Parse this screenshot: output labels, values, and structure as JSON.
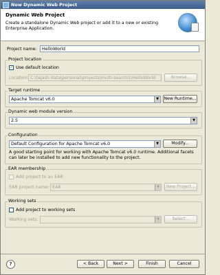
{
  "window": {
    "title": "New Dynamic Web Project"
  },
  "banner": {
    "title": "Dynamic Web Project",
    "description": "Create a standalone Dynamic Web project or add it to a new or existing Enterprise Application.",
    "icon": "globe-wizard-icon"
  },
  "project": {
    "name_label": "Project name:",
    "name_value": "HelloWorld"
  },
  "location": {
    "group_title": "Project location",
    "use_default_label": "Use default location",
    "use_default_checked": true,
    "location_label": "Location:",
    "location_value": "C:\\tejash data\\personal\\projects\\multi-search1\\HelloWorld",
    "browse_label": "Browse..."
  },
  "target_runtime": {
    "group_title": "Target runtime",
    "value": "Apache Tomcat v6.0",
    "new_runtime_label": "New Runtime..."
  },
  "module_version": {
    "group_title": "Dynamic web module version",
    "value": "2.5"
  },
  "configuration": {
    "group_title": "Configuration",
    "value": "Default Configuration for Apache Tomcat v6.0",
    "modify_label": "Modify...",
    "description": "A good starting point for working with Apache Tomcat v6.0 runtime. Additional facets can later be installed to add new functionality to the project."
  },
  "ear": {
    "group_title": "EAR membership",
    "add_label": "Add project to an EAR",
    "project_name_label": "EAR project name:",
    "project_name_value": "EAR",
    "new_project_label": "New Project..."
  },
  "working_sets": {
    "group_title": "Working sets",
    "add_label": "Add project to working sets",
    "sets_label": "Working sets:",
    "sets_value": "",
    "select_label": "Select..."
  },
  "footer": {
    "help_label": "?",
    "back_label": "< Back",
    "next_label": "Next >",
    "finish_label": "Finish",
    "cancel_label": "Cancel"
  },
  "colors": {
    "title_bar": "#4a6b98",
    "window_bg": "#ece9d8",
    "field_border": "#7f9db9"
  }
}
